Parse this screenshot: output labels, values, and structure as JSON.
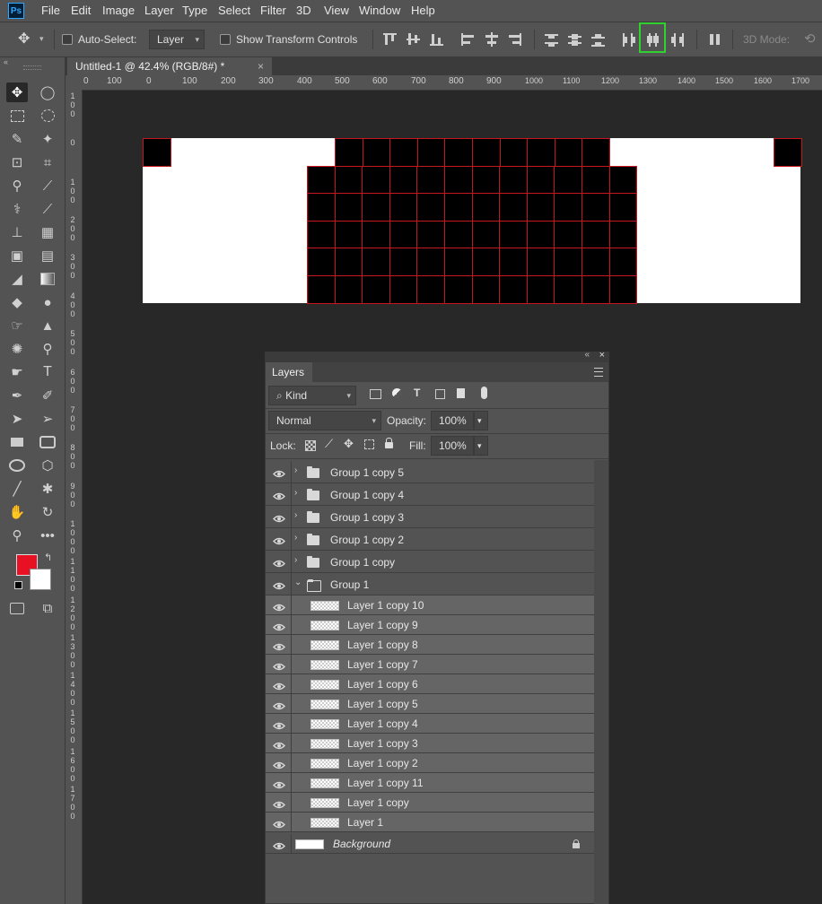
{
  "app": {
    "logo": "Ps"
  },
  "menu": [
    "File",
    "Edit",
    "Image",
    "Layer",
    "Type",
    "Select",
    "Filter",
    "3D",
    "View",
    "Window",
    "Help"
  ],
  "options": {
    "auto_select_label": "Auto-Select:",
    "auto_select_value": "Layer",
    "show_transform_label": "Show Transform Controls",
    "mode_label": "3D Mode:"
  },
  "document": {
    "tab_title": "Untitled-1 @ 42.4% (RGB/8#) *",
    "close_glyph": "×"
  },
  "ruler_h_labels": [
    "0",
    "100",
    "0",
    "100",
    "200",
    "300",
    "400",
    "500",
    "600",
    "700",
    "800",
    "900",
    "1000",
    "1100",
    "1200",
    "1300",
    "1400",
    "1500",
    "1600",
    "1700"
  ],
  "ruler_v_labels": [
    "1\n0\n0",
    "0",
    "1\n0\n0",
    "2\n0\n0",
    "3\n0\n0",
    "4\n0\n0",
    "5\n0\n0",
    "6\n0\n0",
    "7\n0\n0",
    "8\n0\n0",
    "9\n0\n0",
    "1\n0\n0\n0",
    "1\n1\n0\n0",
    "1\n2\n0\n0",
    "1\n3\n0\n0",
    "1\n4\n0\n0",
    "1\n5\n0\n0",
    "1\n6\n0\n0",
    "1\n7\n0\n0"
  ],
  "colors": {
    "foreground": "#e81123",
    "background": "#ffffff",
    "highlight": "#2ed12e",
    "grid_stroke": "#c4171f"
  },
  "layers_panel": {
    "tab": "Layers",
    "kind_label": "Kind",
    "blend_mode": "Normal",
    "opacity_label": "Opacity:",
    "opacity_value": "100%",
    "lock_label": "Lock:",
    "fill_label": "Fill:",
    "fill_value": "100%",
    "groups": [
      "Group 1 copy 5",
      "Group 1 copy 4",
      "Group 1 copy 3",
      "Group 1 copy 2",
      "Group 1 copy",
      "Group 1"
    ],
    "layers": [
      "Layer 1 copy 10",
      "Layer 1 copy 9",
      "Layer 1 copy 8",
      "Layer 1 copy 7",
      "Layer 1 copy 6",
      "Layer 1 copy 5",
      "Layer 1 copy 4",
      "Layer 1 copy 3",
      "Layer 1 copy 2",
      "Layer 1 copy 11",
      "Layer 1 copy",
      "Layer 1"
    ],
    "background_layer": "Background"
  }
}
